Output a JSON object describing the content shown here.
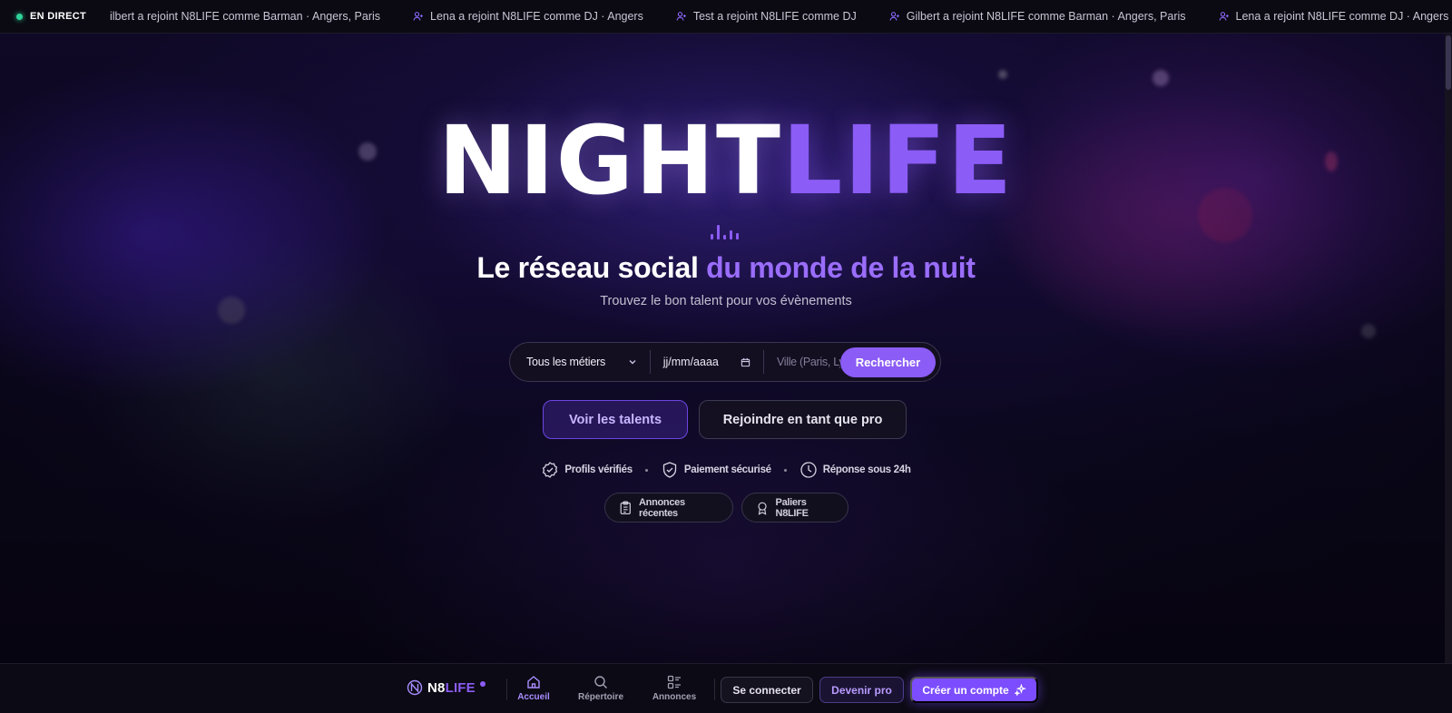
{
  "ticker": {
    "live_label": "EN DIRECT",
    "items": [
      "ilbert a rejoint N8LIFE comme Barman · Angers, Paris",
      "Lena a rejoint N8LIFE comme DJ · Angers",
      "Test a rejoint N8LIFE comme DJ",
      "Gilbert a rejoint N8LIFE comme Barman · Angers, Paris",
      "Lena a rejoint N8LIFE comme DJ · Angers"
    ],
    "icon": "user-plus-icon"
  },
  "hero": {
    "title_white": "NIGHT",
    "title_purple": "LIFE",
    "tagline_white": "Le réseau social",
    "tagline_purple": "du monde de la nuit",
    "subtitle": "Trouvez le bon talent pour vos évènements"
  },
  "search": {
    "job_select": "Tous les métiers",
    "date_value": "jj/mm/aaaa",
    "city_placeholder": "Ville (Paris, Lyon...)",
    "button": "Rechercher"
  },
  "cta": {
    "primary": "Voir les talents",
    "secondary": "Rejoindre en tant que pro"
  },
  "trust": [
    {
      "label": "Profils vérifiés",
      "icon": "badge-check-icon"
    },
    {
      "label": "Paiement sécurisé",
      "icon": "shield-check-icon"
    },
    {
      "label": "Réponse sous 24h",
      "icon": "clock-icon"
    }
  ],
  "pills": [
    {
      "label": "Annonces récentes",
      "icon": "clipboard-icon"
    },
    {
      "label": "Paliers N8LIFE",
      "icon": "award-icon"
    }
  ],
  "bottom_nav": {
    "logo_n8": "N8",
    "logo_life": "LIFE",
    "items": [
      {
        "label": "Accueil",
        "icon": "home-icon",
        "active": true
      },
      {
        "label": "Répertoire",
        "icon": "search-icon",
        "active": false
      },
      {
        "label": "Annonces",
        "icon": "grid-list-icon",
        "active": false
      }
    ],
    "login": "Se connecter",
    "become_pro": "Devenir pro",
    "create_account": "Créer un compte"
  },
  "colors": {
    "accent": "#8b5cf6",
    "live": "#2fd39a",
    "background": "#0a0618"
  }
}
